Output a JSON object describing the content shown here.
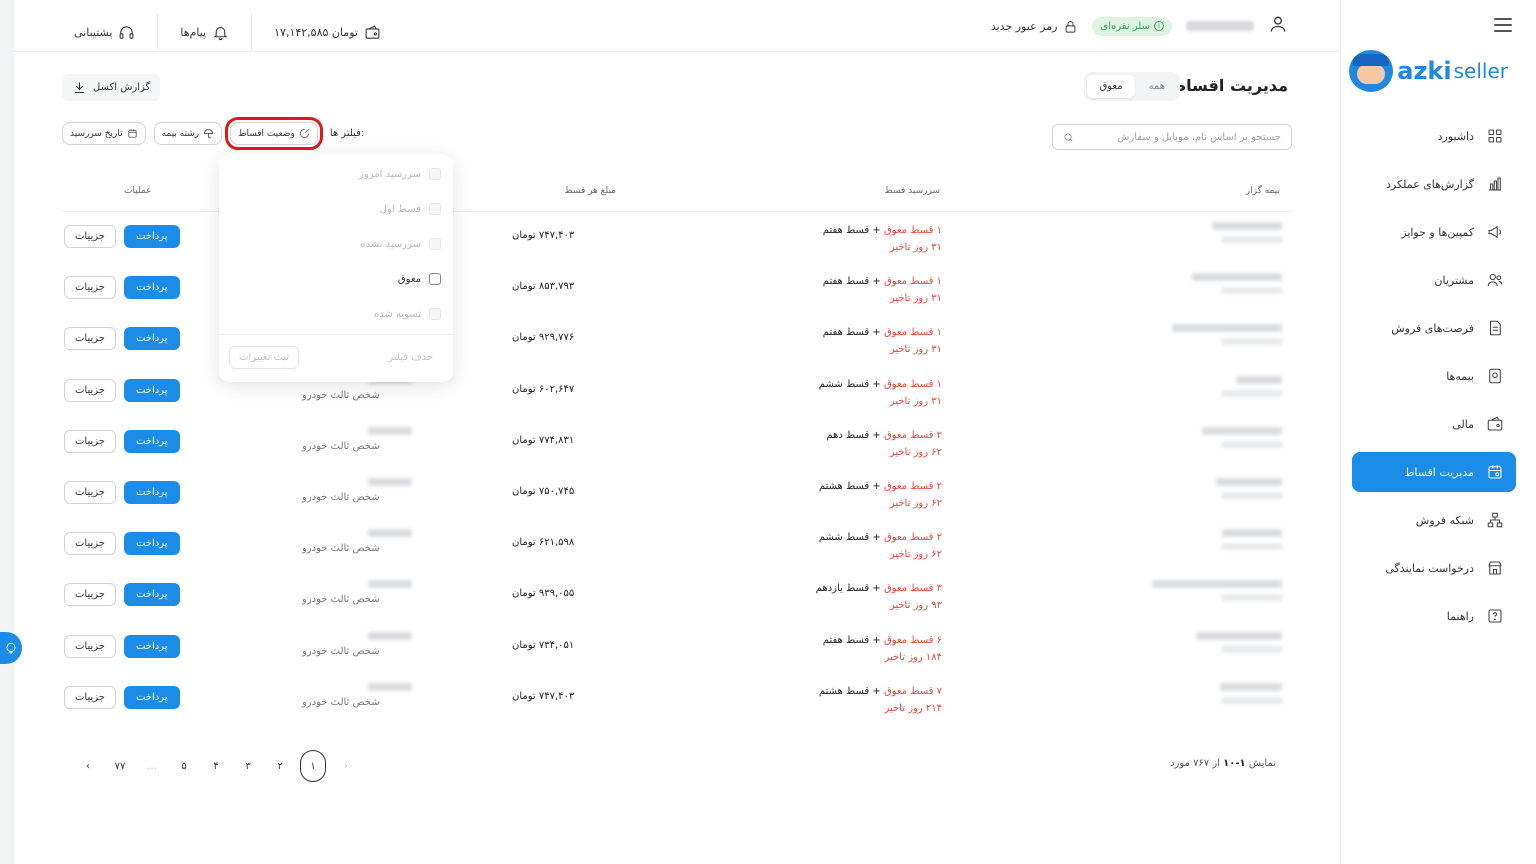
{
  "sidebar": {
    "brand": {
      "azki": "azki",
      "seller": "seller"
    },
    "items": [
      {
        "label": "داشبورد",
        "icon": "dashboard-icon"
      },
      {
        "label": "گزارش‌های عملکرد",
        "icon": "chart-icon"
      },
      {
        "label": "کمپین‌ها و جوایز",
        "icon": "megaphone-icon"
      },
      {
        "label": "مشتریان",
        "icon": "users-icon"
      },
      {
        "label": "فرصت‌های فروش",
        "icon": "document-icon"
      },
      {
        "label": "بیمه‌ها",
        "icon": "policy-icon"
      },
      {
        "label": "مالی",
        "icon": "wallet-icon"
      },
      {
        "label": "مدیریت اقساط",
        "icon": "calendar-icon",
        "active": true
      },
      {
        "label": "شبکه فروش",
        "icon": "network-icon"
      },
      {
        "label": "درخواست نمایندگی",
        "icon": "store-icon"
      },
      {
        "label": "راهنما",
        "icon": "help-icon"
      }
    ]
  },
  "topbar": {
    "badge": "سلر نقره‌ای",
    "password": "رمز عبور جدید",
    "wallet": "۱۷,۱۴۲,۵۸۵ تومان",
    "messages": "پیام‌ها",
    "support": "پشتیبانی"
  },
  "page": {
    "title": "مدیریت اقساط",
    "tabs": [
      "همه",
      "معوق"
    ],
    "active_tab": "معوق",
    "excel": "گزارش اکسل",
    "search_placeholder": "جستجو بر اساس نام، موبایل و سفارش",
    "filters_label": "فیلتر ها:",
    "filter_chips": [
      "تاریخ سررسید",
      "رشته بیمه",
      "وضعیت اقساط"
    ]
  },
  "table": {
    "headers": {
      "insurer": "بیمه گزار",
      "due": "سررسید قسط",
      "amount": "مبلغ هر قسط",
      "field": "شخص ثالث خودرو",
      "actions": "عملیات"
    },
    "pay_label": "پرداخت",
    "details_label": "جزییات",
    "overdue_word": "قسط معوق",
    "rows": [
      {
        "count": "۱",
        "next": "قسط هفتم",
        "delay": "۳۱ روز تاخیر",
        "amount": "۷۴۷,۴۰۳ تومان",
        "field": ""
      },
      {
        "count": "۱",
        "next": "قسط هفتم",
        "delay": "۳۱ روز تاخیر",
        "amount": "۸۵۳,۷۹۳ تومان",
        "field": ""
      },
      {
        "count": "۱",
        "next": "قسط هفتم",
        "delay": "۳۱ روز تاخیر",
        "amount": "۹۲۹,۷۷۶ تومان",
        "field": ""
      },
      {
        "count": "۱",
        "next": "قسط ششم",
        "delay": "۳۱ روز تاخیر",
        "amount": "۶۰۲,۶۴۷ تومان",
        "field": "شخص ثالث خودرو"
      },
      {
        "count": "۲",
        "next": "قسط دهم",
        "delay": "۶۲ روز تاخیر",
        "amount": "۷۷۴,۸۳۱ تومان",
        "field": "شخص ثالث خودرو"
      },
      {
        "count": "۲",
        "next": "قسط هشتم",
        "delay": "۶۲ روز تاخیر",
        "amount": "۷۵۰,۷۴۵ تومان",
        "field": "شخص ثالث خودرو"
      },
      {
        "count": "۲",
        "next": "قسط ششم",
        "delay": "۶۲ روز تاخیر",
        "amount": "۶۲۱,۵۹۸ تومان",
        "field": "شخص ثالث خودرو"
      },
      {
        "count": "۳",
        "next": "قسط یازدهم",
        "delay": "۹۳ روز تاخیر",
        "amount": "۹۳۹,۰۵۵ تومان",
        "field": "شخص ثالث خودرو"
      },
      {
        "count": "۶",
        "next": "قسط هفتم",
        "delay": "۱۸۴ روز تاخیر",
        "amount": "۷۳۴,۰۵۱ تومان",
        "field": "شخص ثالث خودرو"
      },
      {
        "count": "۷",
        "next": "قسط هشتم",
        "delay": "۲۱۴ روز تاخیر",
        "amount": "۷۴۷,۴۰۳ تومان",
        "field": "شخص ثالث خودرو"
      }
    ]
  },
  "dropdown": {
    "options": [
      {
        "label": "سررسید امروز",
        "enabled": false
      },
      {
        "label": "قسط اول",
        "enabled": false
      },
      {
        "label": "سررسید نشده",
        "enabled": false
      },
      {
        "label": "معوق",
        "enabled": true
      },
      {
        "label": "تسویه شده",
        "enabled": false
      }
    ],
    "apply": "ثبت تغییرات",
    "clear": "حذف فیلتر"
  },
  "pagination": {
    "info_prefix": "نمایش",
    "range": "۱-۱۰",
    "of": "از ۷۶۷ مورد",
    "pages": [
      "۱",
      "۲",
      "۳",
      "۴",
      "۵",
      "...",
      "۷۷"
    ],
    "current": "۱"
  }
}
